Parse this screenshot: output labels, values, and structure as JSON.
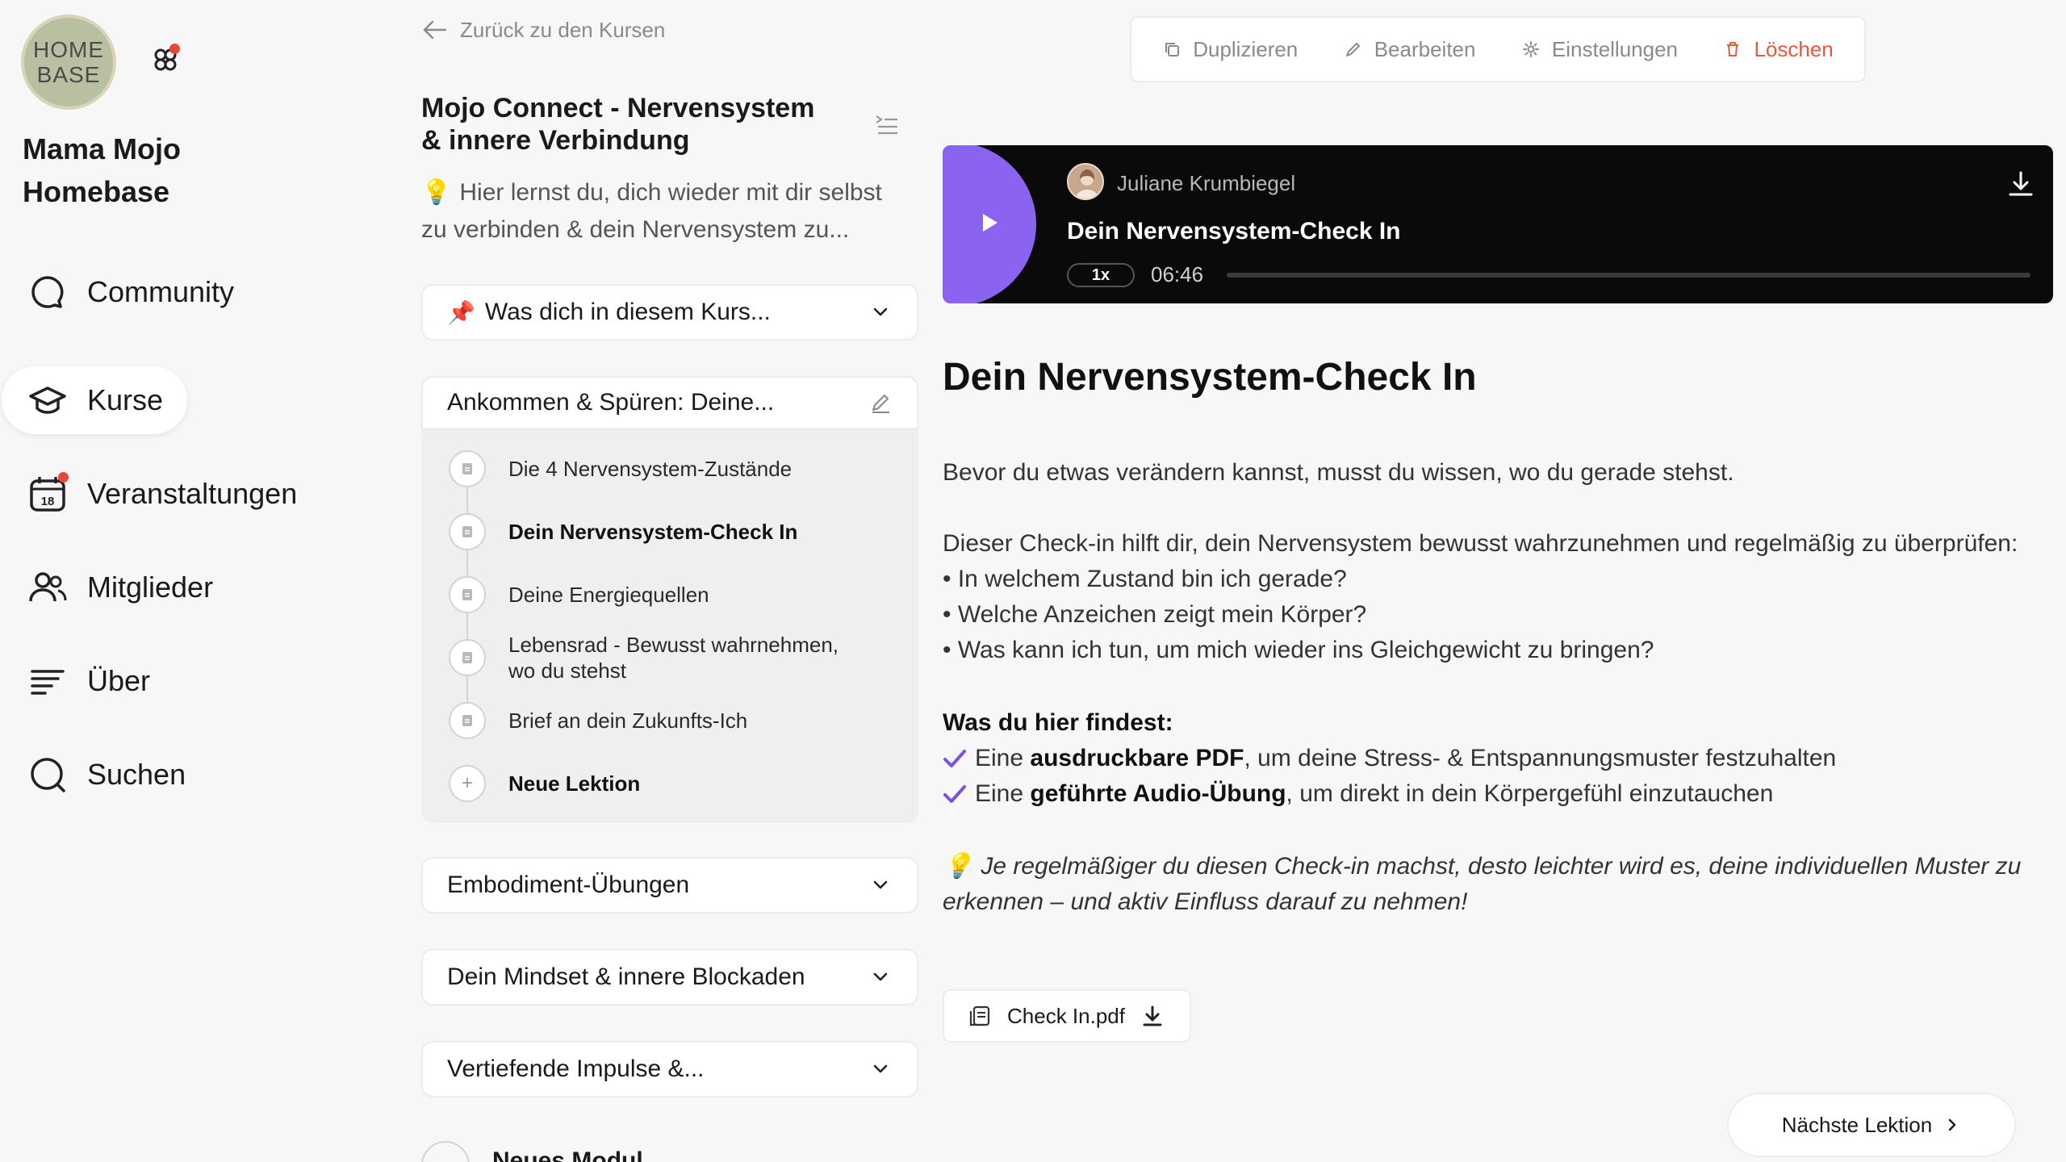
{
  "sidebar": {
    "logo_line1": "HOME",
    "logo_line2": "BASE",
    "brand": "Mama Mojo Homebase",
    "nav": [
      {
        "label": "Community",
        "icon": "chat-bubble-icon"
      },
      {
        "label": "Kurse",
        "icon": "graduation-cap-icon",
        "active": true
      },
      {
        "label": "Veranstaltungen",
        "icon": "calendar-icon",
        "calendar_day": "18"
      },
      {
        "label": "Mitglieder",
        "icon": "members-icon"
      },
      {
        "label": "Über",
        "icon": "about-lines-icon"
      },
      {
        "label": "Suchen",
        "icon": "search-icon"
      }
    ]
  },
  "course": {
    "back_label": "Zurück zu den Kursen",
    "title": "Mojo Connect - Nervensystem & innere Verbindung",
    "description_icon": "💡",
    "description": "Hier lernst du, dich wieder mit dir selbst zu verbinden & dein Nervensystem zu...",
    "intro_card_icon": "📌",
    "intro_card": "Was dich in diesem Kurs...",
    "open_module": {
      "title": "Ankommen & Spüren: Deine...",
      "lessons": [
        "Die 4 Nervensystem-Zustände",
        "Dein Nervensystem-Check In",
        "Deine Energiequellen",
        "Lebensrad - Bewusst wahrnehmen, wo du stehst",
        "Brief an dein Zukunfts-Ich"
      ],
      "new_lesson": "Neue Lektion"
    },
    "modules": [
      "Embodiment-Übungen",
      "Dein Mindset & innere Blockaden",
      "Vertiefende Impulse &..."
    ],
    "new_module": "Neues Modul"
  },
  "toolbar": {
    "duplicate": "Duplizieren",
    "edit": "Bearbeiten",
    "settings": "Einstellungen",
    "delete": "Löschen"
  },
  "player": {
    "author": "Juliane Krumbiegel",
    "title": "Dein Nervensystem-Check In",
    "speed": "1x",
    "time": "06:46",
    "progress": 0
  },
  "lesson": {
    "title": "Dein Nervensystem-Check In",
    "intro": "Bevor du etwas verändern kannst, musst du wissen, wo du gerade stehst.",
    "lead": "Dieser Check-in hilft dir, dein Nervensystem bewusst wahrzunehmen und regelmäßig zu überprüfen:",
    "bullets": [
      "• In welchem Zustand bin ich gerade?",
      "• Welche Anzeichen zeigt mein Körper?",
      "• Was kann ich tun, um mich wieder ins Gleichgewicht zu bringen?"
    ],
    "find_heading": "Was du hier findest:",
    "find_items": [
      {
        "pre": "Eine ",
        "bold": "ausdruckbare PDF",
        "post": ", um deine Stress- & Entspannungsmuster festzuhalten"
      },
      {
        "pre": "Eine ",
        "bold": "geführte Audio-Übung",
        "post": ", um direkt in dein Körpergefühl einzutauchen"
      }
    ],
    "tip_icon": "💡",
    "tip": "Je regelmäßiger du diesen Check-in machst, desto leichter wird es, deine individuellen Muster zu erkennen – und aktiv Einfluss darauf zu nehmen!",
    "file": "Check In.pdf",
    "next": "Nächste Lektion"
  },
  "colors": {
    "accent": "#8a63f0",
    "danger": "#e8583c",
    "notification": "#e8453c"
  }
}
